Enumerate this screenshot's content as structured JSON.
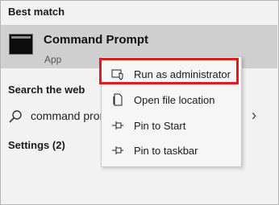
{
  "sections": {
    "best_match": "Best match",
    "search_web": "Search the web",
    "settings": "Settings (2)"
  },
  "best_match_item": {
    "name": "Command Prompt",
    "type": "App",
    "icon": "command-prompt-icon"
  },
  "web_search": {
    "query": "command prompt",
    "icon": "search-icon",
    "chevron_icon": "chevron-right-icon"
  },
  "context_menu": {
    "items": [
      {
        "label": "Run as administrator",
        "icon": "shield-icon"
      },
      {
        "label": "Open file location",
        "icon": "file-icon"
      },
      {
        "label": "Pin to Start",
        "icon": "pin-icon"
      },
      {
        "label": "Pin to taskbar",
        "icon": "pin-icon"
      }
    ]
  },
  "colors": {
    "highlight_border": "#e01b1b",
    "selected_row": "#cfcfcf",
    "background": "#f2f2f2"
  }
}
